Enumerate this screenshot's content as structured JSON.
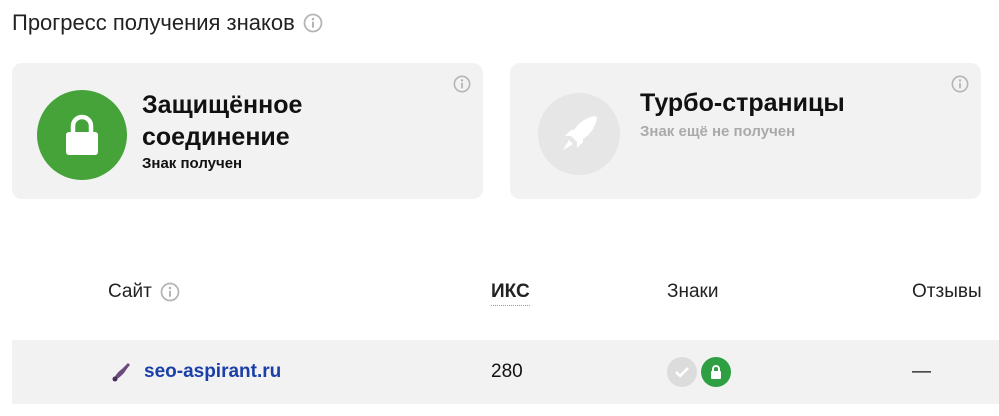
{
  "header": {
    "title": "Прогресс получения знаков",
    "info_icon": "info-icon"
  },
  "cards": [
    {
      "title": "Защищённое соединение",
      "status": "Знак получен",
      "icon": "lock-icon",
      "state": "earned",
      "color": "#45a33a"
    },
    {
      "title": "Турбо-страницы",
      "status": "Знак ещё не получен",
      "icon": "rocket-icon",
      "state": "not-earned",
      "color": "#e6e6e6"
    }
  ],
  "table": {
    "headers": {
      "site": "Сайт",
      "iks": "ИКС",
      "signs": "Знаки",
      "reviews": "Отзывы"
    },
    "rows": [
      {
        "site": "seo-aspirant.ru",
        "iks": "280",
        "signs": [
          "check-icon",
          "lock-icon"
        ],
        "reviews": "—"
      }
    ]
  },
  "colors": {
    "accent_green": "#45a33a",
    "link_blue": "#1a3fa8",
    "card_bg": "#f2f2f2"
  }
}
